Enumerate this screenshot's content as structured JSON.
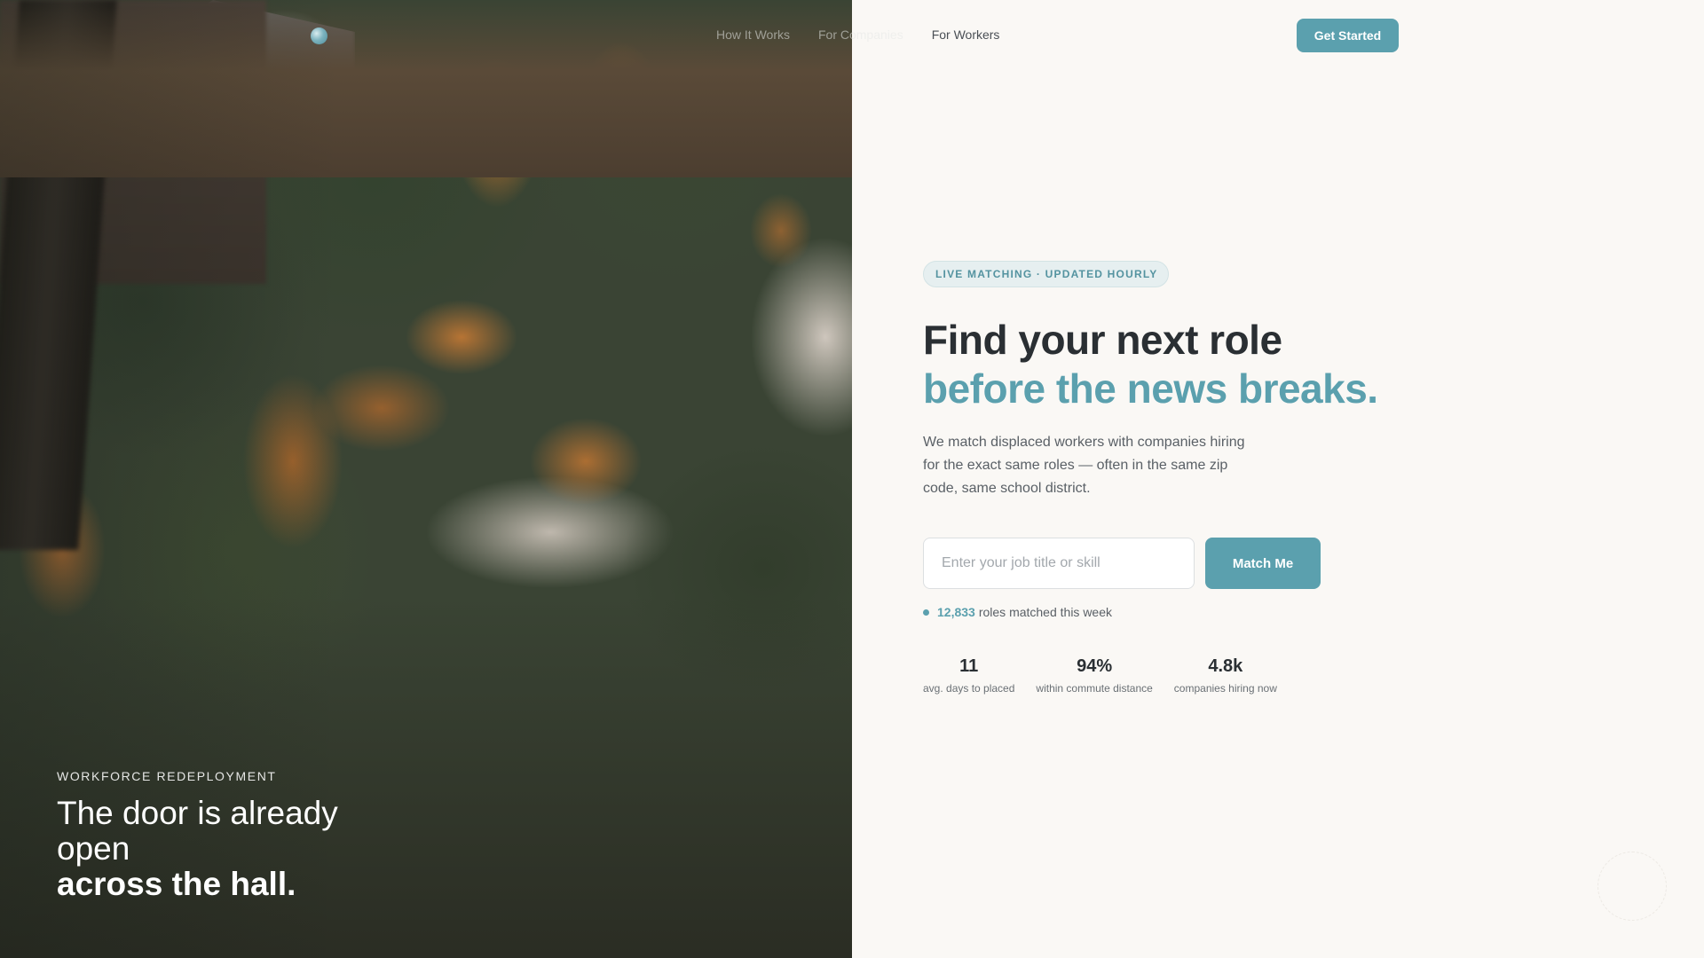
{
  "brand": {
    "logo_text": "",
    "accent_color": "#5ba0ae"
  },
  "nav": {
    "links": [
      "How It Works",
      "For Companies",
      "For Workers"
    ],
    "cta_label": "Get Started"
  },
  "hero_caption": {
    "eyebrow": "WORKFORCE REDEPLOYMENT",
    "line1": "The door is already open",
    "line2": "across the hall."
  },
  "main": {
    "badge": "LIVE MATCHING · UPDATED HOURLY",
    "headline_line1": "Find your next role",
    "headline_line2": "before the news breaks.",
    "subtitle": "We match displaced workers with companies hiring for the exact same roles — often in the same zip code, same school district.",
    "search": {
      "placeholder": "Enter your job title or skill",
      "value": "",
      "button_label": "Match Me"
    },
    "live": {
      "count": "12,833",
      "text": "roles matched this week"
    },
    "stats": [
      {
        "value": "11",
        "label": "avg. days to placed"
      },
      {
        "value": "94%",
        "label": "within commute distance"
      },
      {
        "value": "4.8k",
        "label": "companies hiring now"
      }
    ]
  }
}
